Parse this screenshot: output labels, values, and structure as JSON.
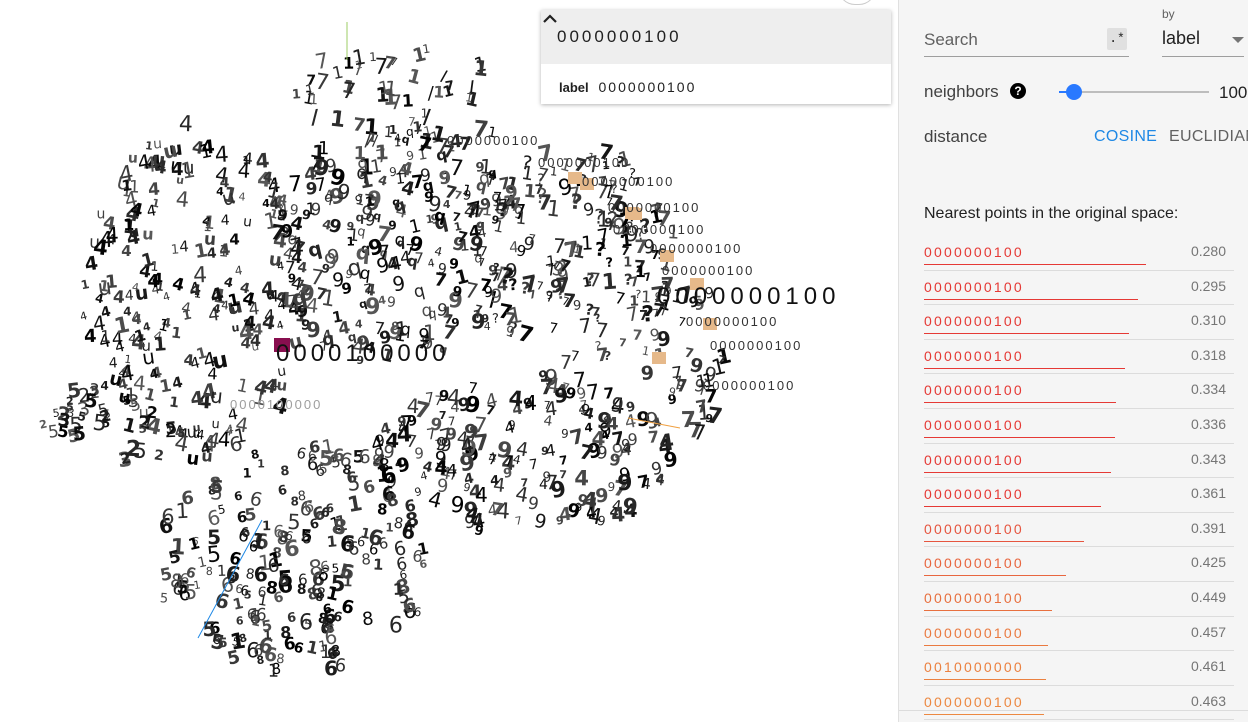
{
  "selected": {
    "title": "0000000100",
    "property_key": "label",
    "property_value": "0000000100"
  },
  "canvas_labels": [
    "0000000100",
    "0000000100",
    "0000000100",
    "0000000100",
    "0000000100",
    "0000000100",
    "0000000100",
    "0000000100",
    "0000000100",
    "0000000100",
    "0000000100",
    "0000100000",
    "0000100000"
  ],
  "inspector": {
    "search_placeholder": "Search",
    "regex_symbol": ".*",
    "by_label": "by",
    "by_value": "label",
    "neighbors_label": "neighbors",
    "neighbors_help": "?",
    "neighbors_value": "100",
    "neighbors_fraction": 0.1,
    "distance_label": "distance",
    "distance_cosine": "COSINE",
    "distance_euclidean": "EUCLIDIAN",
    "nearest_title": "Nearest points in the original space:"
  },
  "nearest": [
    {
      "label": "0000000100",
      "value": "0.280",
      "color": "#e53935"
    },
    {
      "label": "0000000100",
      "value": "0.295",
      "color": "#e53935"
    },
    {
      "label": "0000000100",
      "value": "0.310",
      "color": "#e53935"
    },
    {
      "label": "0000000100",
      "value": "0.318",
      "color": "#e53935"
    },
    {
      "label": "0000000100",
      "value": "0.334",
      "color": "#e53935"
    },
    {
      "label": "0000000100",
      "value": "0.336",
      "color": "#e53935"
    },
    {
      "label": "0000000100",
      "value": "0.343",
      "color": "#e53935"
    },
    {
      "label": "0000000100",
      "value": "0.361",
      "color": "#e53935"
    },
    {
      "label": "0000000100",
      "value": "0.391",
      "color": "#e6553f"
    },
    {
      "label": "0000000100",
      "value": "0.425",
      "color": "#e8663f"
    },
    {
      "label": "0000000100",
      "value": "0.449",
      "color": "#e8703f"
    },
    {
      "label": "0000000100",
      "value": "0.457",
      "color": "#ea7a40"
    },
    {
      "label": "0010000000",
      "value": "0.461",
      "color": "#eb8140"
    },
    {
      "label": "0000000100",
      "value": "0.463",
      "color": "#ec8841"
    }
  ],
  "colors": {
    "accent": "#2979ff",
    "cosine_active": "#1e88e5",
    "highlight_tile": "#e6b98a",
    "selected_tile": "#880e4f"
  }
}
